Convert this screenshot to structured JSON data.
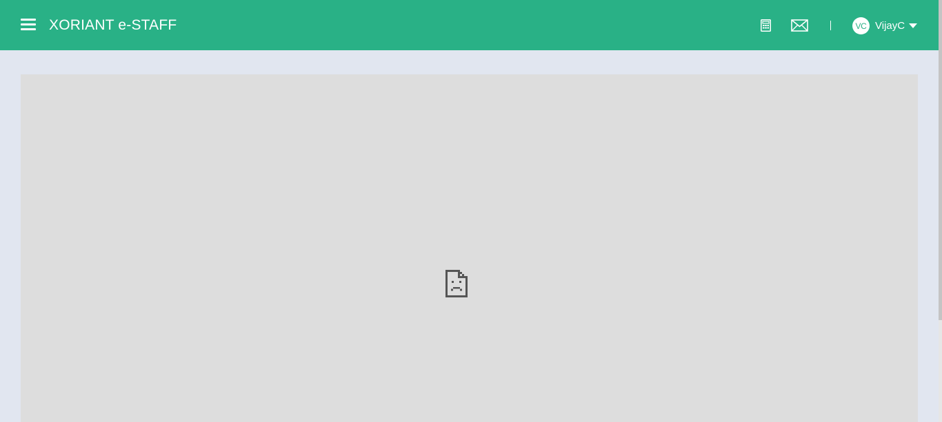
{
  "header": {
    "app_title": "XORIANT e-STAFF",
    "background_color": "#29b186",
    "menu_icon": "hamburger-menu-icon",
    "calculator_icon": "calculator-icon",
    "mail_icon": "mail-icon",
    "separator": "|"
  },
  "user": {
    "initials": "VC",
    "name": "VijayC",
    "dropdown_icon": "caret-down-icon"
  },
  "content": {
    "frame_background": "#dddddd",
    "page_background": "#e1e6f0",
    "placeholder_icon": "broken-document-icon"
  }
}
